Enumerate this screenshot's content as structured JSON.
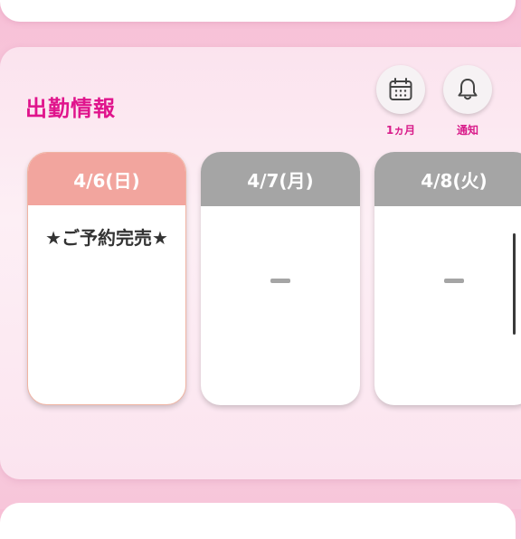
{
  "section": {
    "title": "出勤情報"
  },
  "buttons": {
    "month": {
      "label": "1ヵ月",
      "icon": "calendar-icon"
    },
    "notify": {
      "label": "通知",
      "icon": "bell-icon"
    }
  },
  "days": [
    {
      "date": "4/6(日)",
      "status": "★ご予約完売★",
      "active": true
    },
    {
      "date": "4/7(月)",
      "status": "",
      "active": false
    },
    {
      "date": "4/8(火)",
      "status": "",
      "active": false
    }
  ],
  "colors": {
    "accent": "#e0148c",
    "active_header": "#f2a59e",
    "inactive_header": "#a5a5a5"
  }
}
